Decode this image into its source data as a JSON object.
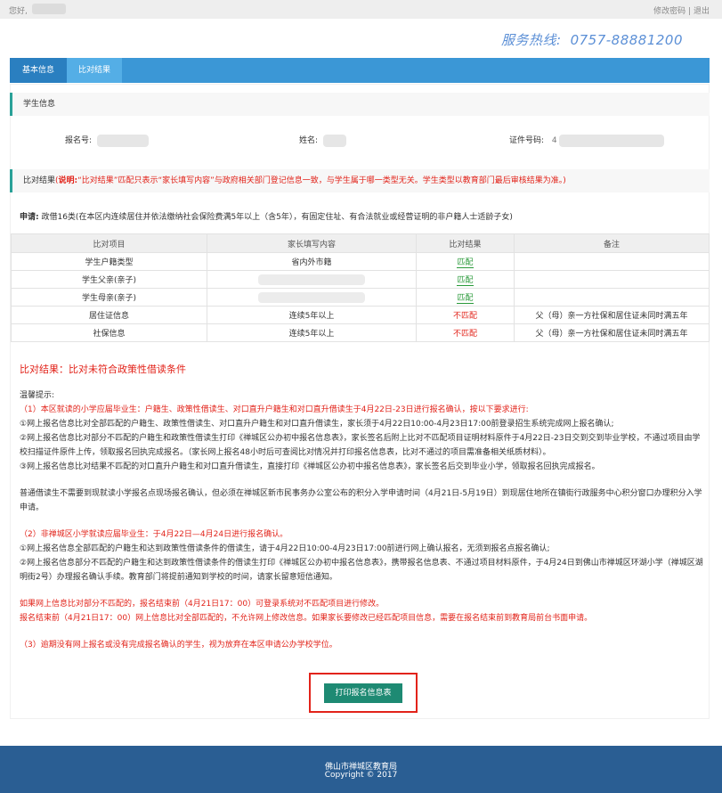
{
  "topbar": {
    "greeting": "您好,",
    "change_password": "修改密码",
    "separator": "|",
    "logout": "退出"
  },
  "hotline": {
    "label": "服务热线:",
    "number": "0757-88881200"
  },
  "nav": {
    "tabs": [
      "基本信息",
      "比对结果"
    ]
  },
  "student_section": {
    "title": "学生信息",
    "reg_no_label": "报名号:",
    "name_label": "姓名:",
    "id_label": "证件号码:",
    "id_prefix": "4"
  },
  "compare_section": {
    "title": "比对结果",
    "note_open": "(",
    "note_label": "说明:",
    "note_text": "“比对结果”匹配只表示“家长填写内容”与政府相关部门登记信息一致，与学生属于哪一类型无关。学生类型以教育部门最后审核结果为准。",
    "note_close": ")"
  },
  "apply": {
    "label": "申请:",
    "text": "政借16类(在本区内连续居住并依法缴纳社会保险费满5年以上（含5年），有固定住址、有合法就业或经营证明的非户籍人士适龄子女)"
  },
  "table": {
    "headers": [
      "比对项目",
      "家长填写内容",
      "比对结果",
      "备注"
    ],
    "rows": [
      {
        "item": "学生户籍类型",
        "content": "省内外市籍",
        "result": "匹配",
        "note": ""
      },
      {
        "item": "学生父亲(亲子)",
        "content": "",
        "result": "匹配",
        "note": ""
      },
      {
        "item": "学生母亲(亲子)",
        "content": "",
        "result": "匹配",
        "note": ""
      },
      {
        "item": "居住证信息",
        "content": "连续5年以上",
        "result": "不匹配",
        "note": "父（母）亲一方社保和居住证未同时满五年"
      },
      {
        "item": "社保信息",
        "content": "连续5年以上",
        "result": "不匹配",
        "note": "父（母）亲一方社保和居住证未同时满五年"
      }
    ]
  },
  "verdict": "比对结果：比对未符合政策性借读条件",
  "notes": {
    "title": "温馨提示:",
    "p1_head": "（1）本区就读的小学应届毕业生：户籍生、政策性借读生、对口直升户籍生和对口直升借读生于4月22日-23日进行报名确认，按以下要求进行:",
    "p1_a": "①网上报名信息比对全部匹配的户籍生、政策性借读生、对口直升户籍生和对口直升借读生，家长须于4月22日10:00-4月23日17:00前登录招生系统完成网上报名确认;",
    "p1_b": "②网上报名信息比对部分不匹配的户籍生和政策性借读生打印《禅城区公办初中报名信息表》，家长签名后附上比对不匹配项目证明材料原件于4月22日-23日交到交到毕业学校，不通过项目由学校扫描证件原件上传，领取报名回执完成报名。（家长网上报名48小时后可查阅比对情况并打印报名信息表，比对不通过的项目需准备相关纸质材料）。",
    "p1_c": "③网上报名信息比对结果不匹配的对口直升户籍生和对口直升借读生，直接打印《禅城区公办初中报名信息表》，家长签名后交到毕业小学，领取报名回执完成报名。",
    "p2": "普通借读生不需要到现就读小学报名点现场报名确认，但必须在禅城区新市民事务办公室公布的积分入学申请时间（4月21日-5月19日）到现居住地所在镇街行政服务中心积分窗口办理积分入学申请。",
    "p3_head": "（2）非禅城区小学就读应届毕业生：于4月22日—4月24日进行报名确认。",
    "p3_a": "①网上报名信息全部匹配的户籍生和达到政策性借读条件的借读生，请于4月22日10:00-4月23日17:00前进行网上确认报名，无须到报名点报名确认;",
    "p3_b": "②网上报名信息部分不匹配的户籍生和达到政策性借读条件的借读生打印《禅城区公办初中报名信息表》，携带报名信息表、不通过项目材料原件，于4月24日到佛山市禅城区环湖小学（禅城区湖明街2号）办理报名确认手续。教育部门将提前通知到学校的时间，请家长留意短信通知。",
    "p4_a": "如果网上信息比对部分不匹配的，报名结束前（4月21日17：00）可登录系统对不匹配项目进行修改。",
    "p4_b": "报名结束前（4月21日17：00）网上信息比对全部匹配的，不允许网上修改信息。如果家长要修改已经匹配项目信息，需要在报名结束前到教育局前台书面申请。",
    "p5": "（3）逾期没有网上报名或没有完成报名确认的学生，视为放弃在本区申请公办学校学位。"
  },
  "print_button": "打印报名信息表",
  "footer": {
    "org": "佛山市禅城区教育局",
    "copyright": "Copyright © 2017"
  },
  "colors": {
    "nav": "#3b97d6",
    "footer": "#2a5e93",
    "button": "#1e8a73",
    "red": "#e2231a",
    "green": "#2a9a3a"
  }
}
